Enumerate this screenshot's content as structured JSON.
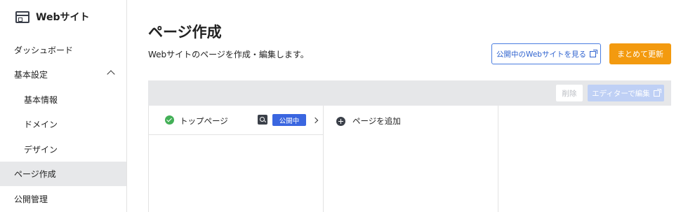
{
  "sidebar": {
    "brand_title": "Webサイト",
    "brand_icon": "browser-window-icon",
    "items": [
      {
        "label": "ダッシュボード"
      },
      {
        "label": "基本設定"
      },
      {
        "label": "基本情報"
      },
      {
        "label": "ドメイン"
      },
      {
        "label": "デザイン"
      },
      {
        "label": "ページ作成"
      },
      {
        "label": "公開管理"
      }
    ],
    "active_item": "ページ作成"
  },
  "main": {
    "title": "ページ作成",
    "description": "Webサイトのページを作成・編集します。",
    "view_site_button": "公開中のWebサイトを見る",
    "publish_button": "まとめて更新"
  },
  "editor": {
    "delete_button": "削除",
    "edit_in_editor_button": "エディターで編集",
    "pages": [
      {
        "name": "トップページ",
        "status": "公開中"
      }
    ],
    "add_page_label": "ページを追加"
  },
  "colors": {
    "accent_blue": "#3a66e0",
    "primary_orange": "#f39a0f",
    "success_green": "#43b057"
  }
}
